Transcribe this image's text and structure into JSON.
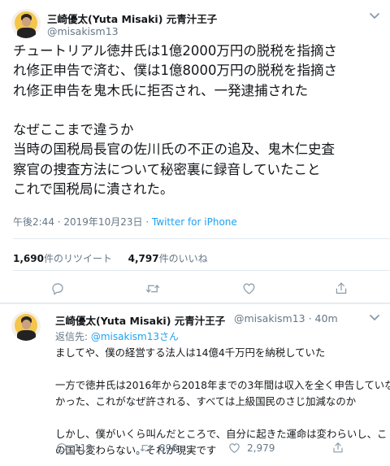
{
  "main_tweet": {
    "author_name": "三崎優太(Yuta Misaki) 元青汁王子",
    "author_handle": "@misakism13",
    "text_lines": [
      "チュートリアル徳井氏は1億2000万円の脱税を指摘さ",
      "れ修正申告で済む、僕は1億8000万円の脱税を指摘さ",
      "れ修正申告を鬼木氏に拒否され、一発逮捕された",
      "",
      "なぜここまで違うか",
      "当時の国税局長官の佐川氏の不正の追及、鬼木仁史査",
      "察官の捜査方法について秘密裏に録音していたこと",
      "これで国税局に潰された。"
    ],
    "timestamp": "午後2:44 · 2019年10月23日 · ",
    "client": "Twitter for iPhone",
    "retweets_count": "1,690",
    "retweets_label": "件のリツイート",
    "likes_count": "4,797",
    "likes_label": "件のいいね"
  },
  "reply_tweet": {
    "author_name": "三崎優太(Yuta Misaki) 元青汁王子",
    "author_handle": "@misakism13 · 40m",
    "reply_prefix": "返信先: ",
    "reply_target": "@misakism13さん",
    "text_lines": [
      "ましてや、僕の経営する法人は14億4千万円を納税していた",
      "",
      "一方で徳井氏は2016年から2018年までの3年間は収入を全く申告していな",
      "かった、これがなぜ許される、すべては上級国民のさじ加減なのか",
      "",
      "しかし、僕がいくら叫んだところで、自分に起きた運命は変わらいし、こ",
      "の国も変わらない。それが現実です"
    ],
    "reply_count": "119",
    "retweet_count": "896",
    "like_count": "2,979"
  },
  "icons": [
    "chevron-down-icon",
    "reply-icon",
    "retweet-icon",
    "like-icon",
    "share-icon"
  ],
  "colors": {
    "link": "#1da1f2",
    "secondary": "#657786",
    "text": "#14171a",
    "divider": "#e1e8ed"
  }
}
